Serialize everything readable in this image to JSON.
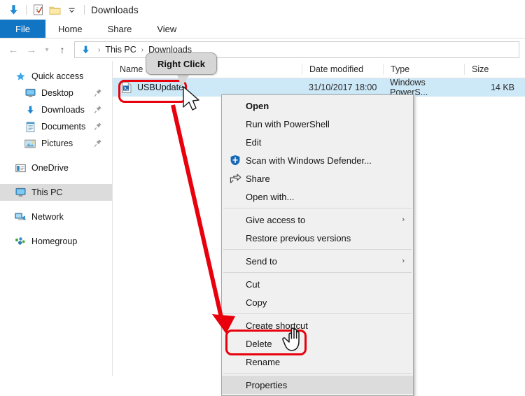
{
  "window": {
    "title": "Downloads",
    "titlebar_icons": [
      "downloads-arrow-icon",
      "properties-checklist-icon",
      "folder-icon",
      "customize-chevron-icon"
    ]
  },
  "ribbon": {
    "tabs": [
      {
        "label": "File",
        "active": true
      },
      {
        "label": "Home",
        "active": false
      },
      {
        "label": "Share",
        "active": false
      },
      {
        "label": "View",
        "active": false
      }
    ],
    "file_tab_color": "#1175c4"
  },
  "address": {
    "back_icon": "back-arrow-icon",
    "forward_icon": "forward-arrow-icon",
    "recent_icon": "recent-locations-chevron-icon",
    "up_icon": "up-arrow-icon",
    "path_icon": "downloads-arrow-icon",
    "crumbs": [
      "This PC",
      "Downloads"
    ],
    "separator": "›"
  },
  "sidebar": {
    "items": [
      {
        "label": "Quick access",
        "icon": "star-icon",
        "indent": false,
        "pinned": false,
        "selected": false,
        "gap": false
      },
      {
        "label": "Desktop",
        "icon": "monitor-icon",
        "indent": true,
        "pinned": true,
        "selected": false,
        "gap": false
      },
      {
        "label": "Downloads",
        "icon": "downloads-arrow-icon",
        "indent": true,
        "pinned": true,
        "selected": false,
        "gap": false
      },
      {
        "label": "Documents",
        "icon": "documents-icon",
        "indent": true,
        "pinned": true,
        "selected": false,
        "gap": false
      },
      {
        "label": "Pictures",
        "icon": "pictures-icon",
        "indent": true,
        "pinned": true,
        "selected": false,
        "gap": false
      },
      {
        "label": "OneDrive",
        "icon": "onedrive-icon",
        "indent": false,
        "pinned": false,
        "selected": false,
        "gap": true
      },
      {
        "label": "This PC",
        "icon": "monitor-icon",
        "indent": false,
        "pinned": false,
        "selected": true,
        "gap": true
      },
      {
        "label": "Network",
        "icon": "network-icon",
        "indent": false,
        "pinned": false,
        "selected": false,
        "gap": true
      },
      {
        "label": "Homegroup",
        "icon": "homegroup-icon",
        "indent": false,
        "pinned": false,
        "selected": false,
        "gap": true
      }
    ]
  },
  "filelist": {
    "columns": [
      "Name",
      "Date modified",
      "Type",
      "Size"
    ],
    "rows": [
      {
        "name": "USBUpdate",
        "date_modified": "31/10/2017 18:00",
        "type": "Windows PowerS...",
        "size": "14 KB",
        "icon": "powershell-script-file-icon",
        "selected": true
      }
    ]
  },
  "context_menu": {
    "groups": [
      [
        {
          "label": "Open",
          "bold": true,
          "icon": null,
          "submenu": false,
          "highlight": false
        },
        {
          "label": "Run with PowerShell",
          "bold": false,
          "icon": null,
          "submenu": false,
          "highlight": false
        },
        {
          "label": "Edit",
          "bold": false,
          "icon": null,
          "submenu": false,
          "highlight": false
        },
        {
          "label": "Scan with Windows Defender...",
          "bold": false,
          "icon": "defender-shield-icon",
          "submenu": false,
          "highlight": false
        },
        {
          "label": "Share",
          "bold": false,
          "icon": "share-icon",
          "submenu": false,
          "highlight": false
        },
        {
          "label": "Open with...",
          "bold": false,
          "icon": null,
          "submenu": false,
          "highlight": false
        }
      ],
      [
        {
          "label": "Give access to",
          "bold": false,
          "icon": null,
          "submenu": true,
          "highlight": false
        },
        {
          "label": "Restore previous versions",
          "bold": false,
          "icon": null,
          "submenu": false,
          "highlight": false
        }
      ],
      [
        {
          "label": "Send to",
          "bold": false,
          "icon": null,
          "submenu": true,
          "highlight": false
        }
      ],
      [
        {
          "label": "Cut",
          "bold": false,
          "icon": null,
          "submenu": false,
          "highlight": false
        },
        {
          "label": "Copy",
          "bold": false,
          "icon": null,
          "submenu": false,
          "highlight": false
        }
      ],
      [
        {
          "label": "Create shortcut",
          "bold": false,
          "icon": null,
          "submenu": false,
          "highlight": false
        },
        {
          "label": "Delete",
          "bold": false,
          "icon": null,
          "submenu": false,
          "highlight": false
        },
        {
          "label": "Rename",
          "bold": false,
          "icon": null,
          "submenu": false,
          "highlight": false
        }
      ],
      [
        {
          "label": "Properties",
          "bold": false,
          "icon": null,
          "submenu": false,
          "highlight": true
        }
      ]
    ],
    "submenu_arrow": "›"
  },
  "annotations": {
    "callout_label": "Right Click",
    "highlight_color": "#e8000d",
    "arrow_color": "#e8000d",
    "arrow_from": "USBUpdate file",
    "arrow_to": "Properties menu item",
    "cursors": [
      "arrow-cursor",
      "hand-pointer-cursor"
    ]
  }
}
